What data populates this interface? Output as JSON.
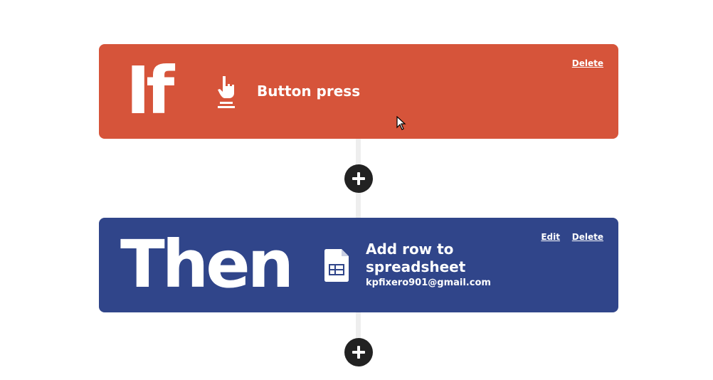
{
  "trigger": {
    "keyword": "If",
    "title": "Button press",
    "icon": "button-press-icon",
    "delete_label": "Delete",
    "color": "#d6543a"
  },
  "action": {
    "keyword": "Then",
    "title": "Add row to spreadsheet",
    "account": "kpfixero901@gmail.com",
    "icon": "spreadsheet-icon",
    "edit_label": "Edit",
    "delete_label": "Delete",
    "color": "#30458a"
  },
  "add_button_icon": "plus-icon"
}
